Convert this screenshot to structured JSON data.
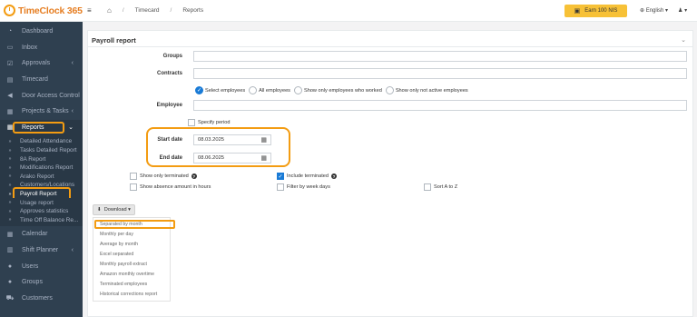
{
  "brand": {
    "name": "TimeClock 365"
  },
  "sidebar": {
    "items": [
      {
        "icon": "dashboard-icon",
        "label": "Dashboard"
      },
      {
        "icon": "inbox-icon",
        "label": "Inbox"
      },
      {
        "icon": "approvals-icon",
        "label": "Approvals",
        "arrow": "‹"
      },
      {
        "icon": "timecard-icon",
        "label": "Timecard"
      },
      {
        "icon": "door-icon",
        "label": "Door Access Control"
      },
      {
        "icon": "projects-icon",
        "label": "Projects & Tasks",
        "arrow": "‹"
      },
      {
        "icon": "reports-icon",
        "label": "Reports",
        "arrow": "⌄"
      }
    ],
    "report_subitems": [
      "Detailed Attendance",
      "Tasks Detailed Report",
      "8A Report",
      "Modifications Report",
      "Arako Report",
      "Customers/Locations",
      "Payroll Report",
      "Usage report",
      "Approves statistics",
      "Time Off Balance Re..."
    ],
    "bottom_items": [
      {
        "icon": "calendar-icon",
        "label": "Calendar"
      },
      {
        "icon": "shift-planner-icon",
        "label": "Shift Planner",
        "arrow": "‹"
      },
      {
        "icon": "users-icon",
        "label": "Users"
      },
      {
        "icon": "groups-icon",
        "label": "Groups"
      },
      {
        "icon": "customers-icon",
        "label": "Customers"
      }
    ]
  },
  "topbar": {
    "menu_icon": "≡",
    "home_icon": "⌂",
    "breadcrumbs": [
      "Timecard",
      "Reports"
    ],
    "earn_label": "Earn 100 NIS",
    "language": "English ▾",
    "user": "▾"
  },
  "panel": {
    "title": "Payroll report",
    "collapse": "⌄",
    "groups_label": "Groups",
    "contracts_label": "Contracts",
    "employee_label": "Employee",
    "radio_options": [
      "Select employees",
      "All employees",
      "Show only employees who worked",
      "Show only not active employees"
    ],
    "specify_period": "Specify period",
    "start_date_label": "Start date",
    "start_date_value": "08.03.2025",
    "end_date_label": "End date",
    "end_date_value": "08.06.2025",
    "opt_show_only_terminated": "Show only terminated",
    "opt_include_terminated": "Include terminated",
    "opt_show_absence": "Show absence amount in hours",
    "opt_filter_week": "Filter by week days",
    "opt_sort": "Sort A to Z",
    "download_label": "Download ▾",
    "download_options": [
      "Separated by month",
      "Monthly per day",
      "Average by month",
      "Excel separated",
      "Monthly payroll extract",
      "Amazon monthly overtime",
      "Terminated employees",
      "Historical corrections report"
    ]
  },
  "colors": {
    "accent": "#f39c12",
    "sidebar": "#2f4050",
    "primary": "#1a7bd6",
    "earn": "#f7c137"
  }
}
